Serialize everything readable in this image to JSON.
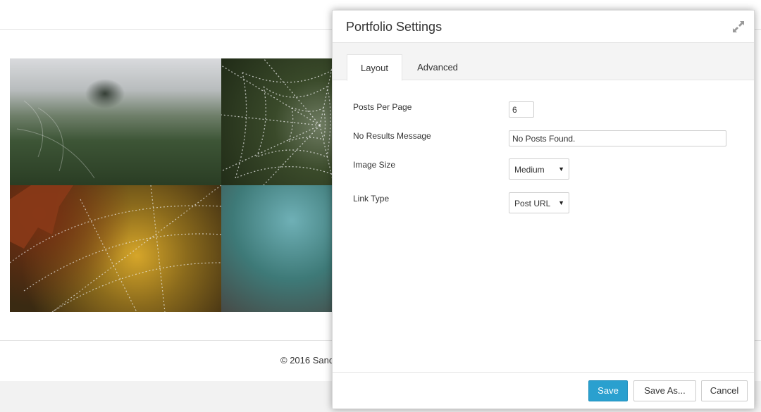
{
  "background": {
    "footer_text": "© 2016 Sand"
  },
  "modal": {
    "title": "Portfolio Settings",
    "expand_icon": "expand-arrows-icon",
    "tabs": [
      {
        "label": "Layout",
        "active": true
      },
      {
        "label": "Advanced",
        "active": false
      }
    ],
    "fields": {
      "posts_per_page": {
        "label": "Posts Per Page",
        "value": "6"
      },
      "no_results_message": {
        "label": "No Results Message",
        "value": "No Posts Found."
      },
      "image_size": {
        "label": "Image Size",
        "value": "Medium"
      },
      "link_type": {
        "label": "Link Type",
        "value": "Post URL"
      }
    },
    "buttons": {
      "save": "Save",
      "save_as": "Save As...",
      "cancel": "Cancel"
    }
  },
  "colors": {
    "primary_button": "#2aa0cf",
    "tab_bar": "#f4f4f4"
  }
}
